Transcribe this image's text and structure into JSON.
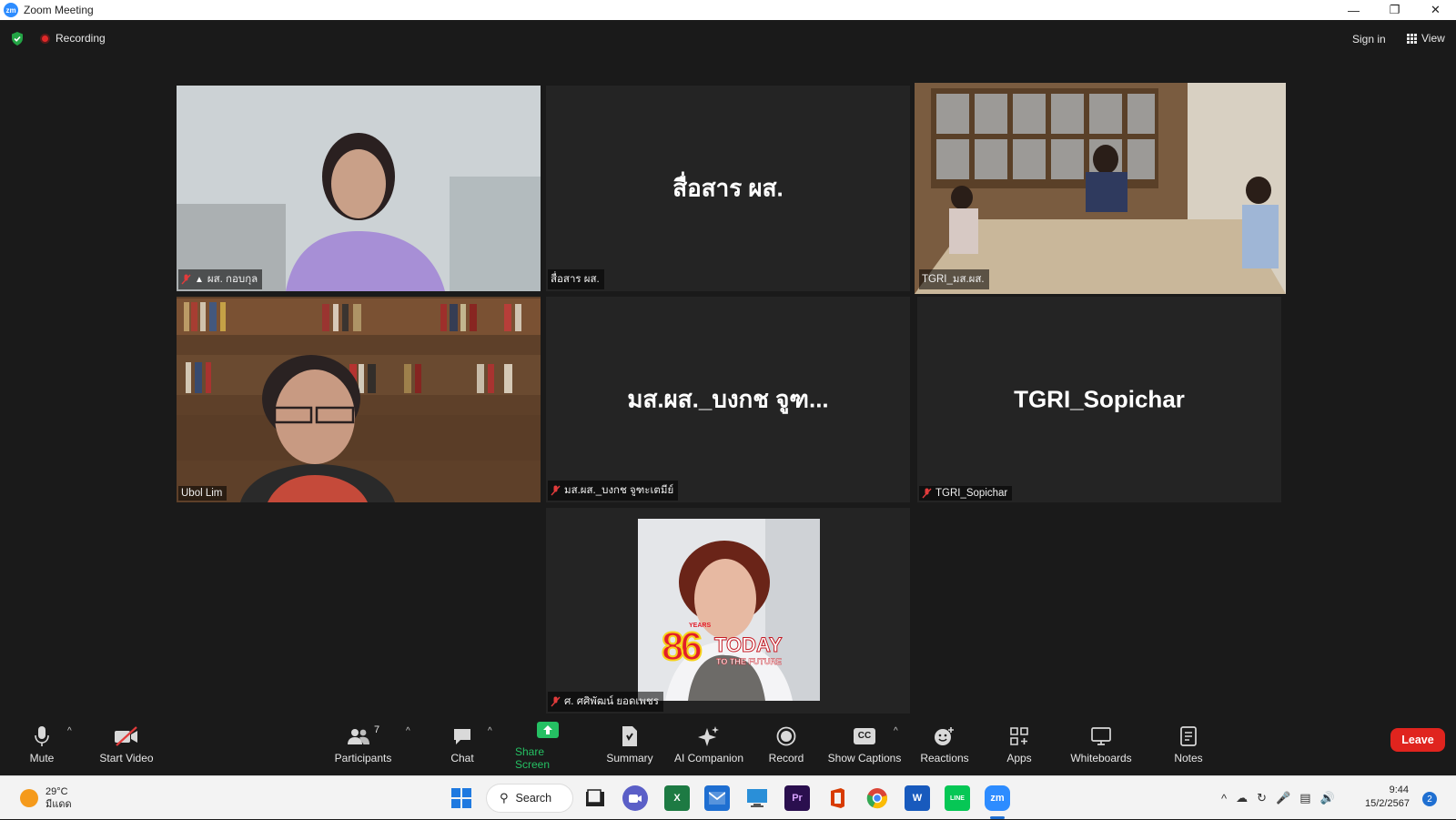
{
  "window": {
    "title": "Zoom Meeting",
    "logo_text": "zm"
  },
  "topbar": {
    "recording_label": "Recording",
    "signin_label": "Sign in",
    "view_label": "View"
  },
  "tiles": [
    {
      "name": "ผส. กอบกุล",
      "muted": true,
      "pinned": true,
      "video": true
    },
    {
      "name": "สื่อสาร ผส.",
      "display_name": "สื่อสาร ผส.",
      "video": false
    },
    {
      "name": "TGRI_มส.ผส.",
      "video": true,
      "active_speaker": true
    },
    {
      "name": "Ubol Lim",
      "video": true
    },
    {
      "name": "มส.ผส._บงกช จูฑะเตมีย์",
      "display_name": "มส.ผส._บงกช จูฑ...",
      "muted": true,
      "video": false
    },
    {
      "name": "TGRI_Sopichar",
      "display_name": "TGRI_Sopichar",
      "muted": true,
      "video": false
    },
    {
      "name": "ศ. ศศิพัฒน์ ยอดเพชร",
      "muted": true,
      "video": true,
      "overlay": {
        "number": "86",
        "years": "YEARS",
        "today": "TODAY",
        "tagline": "TO THE FUTURE"
      }
    }
  ],
  "toolbar": {
    "mute_label": "Mute",
    "start_video_label": "Start Video",
    "participants_label": "Participants",
    "participants_count": "7",
    "chat_label": "Chat",
    "share_screen_label": "Share Screen",
    "summary_label": "Summary",
    "ai_companion_label": "AI Companion",
    "record_label": "Record",
    "show_captions_label": "Show Captions",
    "captions_icon_text": "CC",
    "reactions_label": "Reactions",
    "apps_label": "Apps",
    "whiteboards_label": "Whiteboards",
    "notes_label": "Notes",
    "leave_label": "Leave"
  },
  "taskbar": {
    "weather_temp": "29°C",
    "weather_desc": "มีแดด",
    "search_label": "Search",
    "time": "9:44",
    "date": "15/2/2567",
    "notification_count": "2",
    "apps": [
      {
        "name": "start-icon",
        "color": "#1f7ae0"
      },
      {
        "name": "file-explorer-icon",
        "color": "#222222"
      },
      {
        "name": "teams-icon",
        "color": "#5b5fc7"
      },
      {
        "name": "excel-icon",
        "color": "#1d7a43",
        "text": "X"
      },
      {
        "name": "mail-icon",
        "color": "#1f6fd1"
      },
      {
        "name": "remote-desktop-icon",
        "color": "#2a8fd8"
      },
      {
        "name": "premiere-icon",
        "color": "#2a0f4e",
        "text": "Pr"
      },
      {
        "name": "office-icon",
        "color": "#d83b01"
      },
      {
        "name": "chrome-icon",
        "color": "#34a853"
      },
      {
        "name": "word-icon",
        "color": "#185abd",
        "text": "W"
      },
      {
        "name": "line-icon",
        "color": "#06c755",
        "text": "LINE"
      },
      {
        "name": "zoom-taskbar-icon",
        "color": "#2d8cff",
        "text": "zm"
      }
    ]
  }
}
